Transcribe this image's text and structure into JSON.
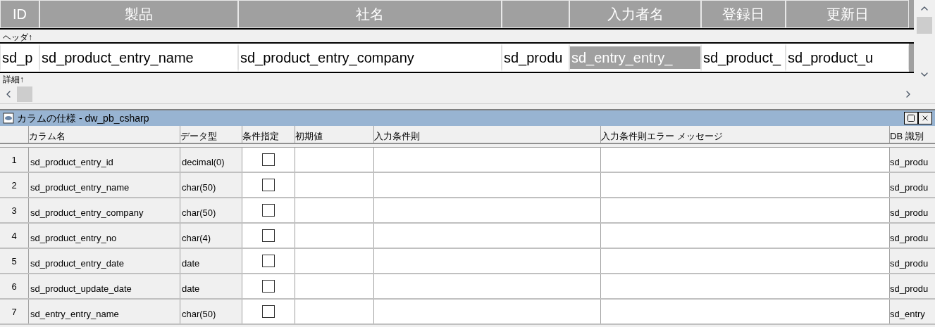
{
  "design": {
    "columns": [
      {
        "header": "ID",
        "detail": "sd_p",
        "selected": false
      },
      {
        "header": "製品",
        "detail": "sd_product_entry_name",
        "selected": false
      },
      {
        "header": "社名",
        "detail": "sd_product_entry_company",
        "selected": false
      },
      {
        "detail": "sd_produ",
        "selected": false
      },
      {
        "header": "入力者名",
        "detail": "sd_entry_entry_",
        "selected": true
      },
      {
        "header": "登録日",
        "detail": "sd_product_",
        "selected": false
      },
      {
        "header": "更新日",
        "detail": "sd_product_u",
        "selected": false
      }
    ],
    "header_band": "ヘッダ↑",
    "detail_band": "詳細↑"
  },
  "panel": {
    "title": "カラムの仕様 - dw_pb_csharp",
    "columns": [
      "カラム名",
      "データ型",
      "条件指定",
      "初期値",
      "入力条件則",
      "入力条件則エラー メッセージ",
      "DB 識別"
    ],
    "rows": [
      {
        "number": "1",
        "name": "sd_product_entry_id",
        "type": "decimal(0)",
        "checked": false,
        "db": "sd_produ"
      },
      {
        "number": "2",
        "name": "sd_product_entry_name",
        "type": "char(50)",
        "checked": false,
        "db": "sd_produ"
      },
      {
        "number": "3",
        "name": "sd_product_entry_company",
        "type": "char(50)",
        "checked": false,
        "db": "sd_produ"
      },
      {
        "number": "4",
        "name": "sd_product_entry_no",
        "type": "char(4)",
        "checked": false,
        "db": "sd_produ"
      },
      {
        "number": "5",
        "name": "sd_product_entry_date",
        "type": "date",
        "checked": false,
        "db": "sd_produ"
      },
      {
        "number": "6",
        "name": "sd_product_update_date",
        "type": "date",
        "checked": false,
        "db": "sd_produ"
      },
      {
        "number": "7",
        "name": "sd_entry_entry_name",
        "type": "char(50)",
        "checked": false,
        "db": "sd_entry"
      }
    ]
  }
}
